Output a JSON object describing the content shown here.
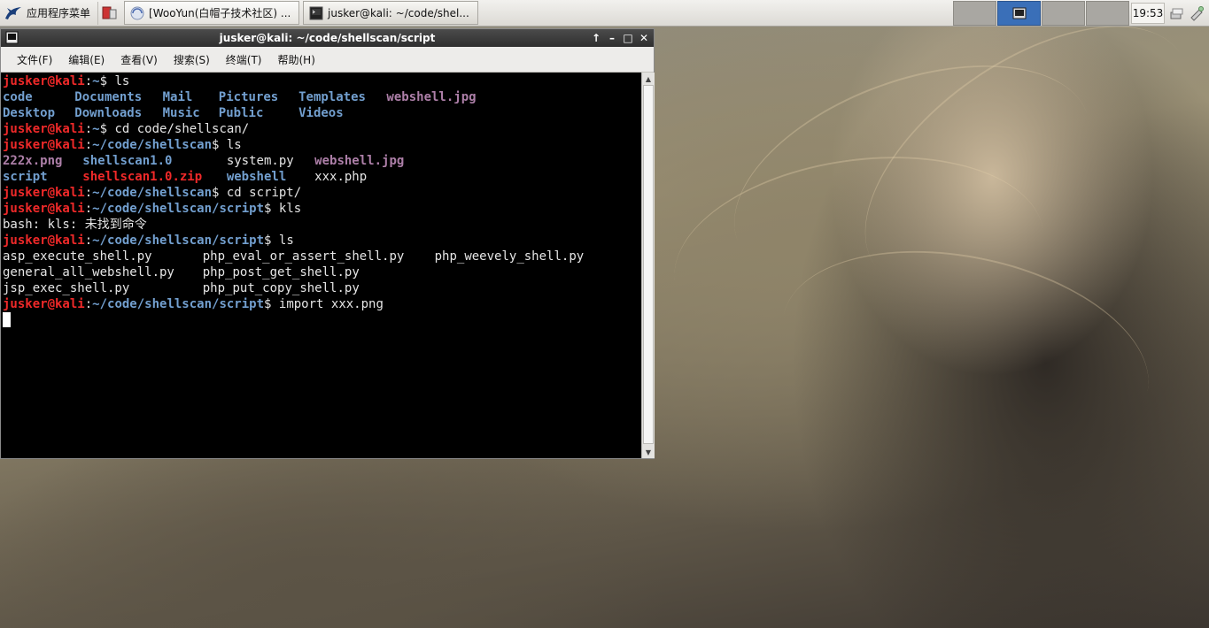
{
  "panel": {
    "app_menu_label": "应用程序菜单",
    "tasks": [
      {
        "label": "[WooYun(白帽子技术社区) ..."
      },
      {
        "label": "jusker@kali: ~/code/shel..."
      }
    ],
    "clock": "19:53"
  },
  "terminal": {
    "title": "jusker@kali: ~/code/shellscan/script",
    "title_buttons": [
      "↑",
      "–",
      "□",
      "✕"
    ],
    "menu": [
      "文件(F)",
      "编辑(E)",
      "查看(V)",
      "搜索(S)",
      "终端(T)",
      "帮助(H)"
    ],
    "user": "jusker@kali",
    "lines": [
      {
        "kind": "prompt",
        "path": "~",
        "cmd": " ls"
      },
      {
        "kind": "ls",
        "items": [
          {
            "text": "code",
            "type": "dir",
            "w": 9
          },
          {
            "text": "Documents",
            "type": "dir",
            "w": 11
          },
          {
            "text": "Mail",
            "type": "dir",
            "w": 7
          },
          {
            "text": "Pictures",
            "type": "dir",
            "w": 10
          },
          {
            "text": "Templates",
            "type": "dir",
            "w": 11
          },
          {
            "text": "webshell.jpg",
            "type": "img",
            "w": 0
          }
        ]
      },
      {
        "kind": "ls",
        "items": [
          {
            "text": "Desktop",
            "type": "dir",
            "w": 9
          },
          {
            "text": "Downloads",
            "type": "dir",
            "w": 11
          },
          {
            "text": "Music",
            "type": "dir",
            "w": 7
          },
          {
            "text": "Public",
            "type": "dir",
            "w": 10
          },
          {
            "text": "Videos",
            "type": "dir",
            "w": 0
          }
        ]
      },
      {
        "kind": "prompt",
        "path": "~",
        "cmd": " cd code/shellscan/"
      },
      {
        "kind": "prompt",
        "path": "~/code/shellscan",
        "cmd": " ls"
      },
      {
        "kind": "ls",
        "items": [
          {
            "text": "222x.png",
            "type": "img",
            "w": 10
          },
          {
            "text": "shellscan1.0",
            "type": "dir",
            "w": 18
          },
          {
            "text": "system.py",
            "type": "file",
            "w": 11
          },
          {
            "text": "webshell.jpg",
            "type": "img",
            "w": 0
          }
        ]
      },
      {
        "kind": "ls",
        "items": [
          {
            "text": "script",
            "type": "dir",
            "w": 10
          },
          {
            "text": "shellscan1.0.zip",
            "type": "zip",
            "w": 18
          },
          {
            "text": "webshell",
            "type": "dir",
            "w": 11
          },
          {
            "text": "xxx.php",
            "type": "file",
            "w": 0
          }
        ]
      },
      {
        "kind": "prompt",
        "path": "~/code/shellscan",
        "cmd": " cd script/"
      },
      {
        "kind": "prompt",
        "path": "~/code/shellscan/script",
        "cmd": " kls"
      },
      {
        "kind": "text",
        "text": "bash: kls: 未找到命令"
      },
      {
        "kind": "prompt",
        "path": "~/code/shellscan/script",
        "cmd": " ls"
      },
      {
        "kind": "ls",
        "items": [
          {
            "text": "asp_execute_shell.py",
            "type": "file",
            "w": 25
          },
          {
            "text": "php_eval_or_assert_shell.py",
            "type": "file",
            "w": 29
          },
          {
            "text": "php_weevely_shell.py",
            "type": "file",
            "w": 0
          }
        ]
      },
      {
        "kind": "ls",
        "items": [
          {
            "text": "general_all_webshell.py",
            "type": "file",
            "w": 25
          },
          {
            "text": "php_post_get_shell.py",
            "type": "file",
            "w": 0
          }
        ]
      },
      {
        "kind": "ls",
        "items": [
          {
            "text": "jsp_exec_shell.py",
            "type": "file",
            "w": 25
          },
          {
            "text": "php_put_copy_shell.py",
            "type": "file",
            "w": 0
          }
        ]
      },
      {
        "kind": "prompt",
        "path": "~/code/shellscan/script",
        "cmd": " import xxx.png"
      },
      {
        "kind": "cursor"
      }
    ]
  },
  "colors": {
    "user": "#ef2929",
    "path": "#729fcf",
    "directory": "#729fcf",
    "image": "#ad7fa8",
    "archive": "#ef2929",
    "text": "#e5e5e5",
    "workspace_active": "#3a6fb8"
  }
}
